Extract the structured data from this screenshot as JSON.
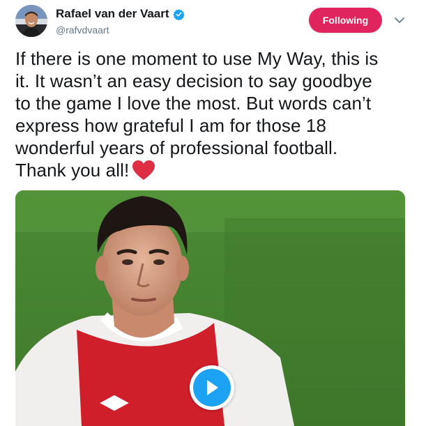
{
  "tweet": {
    "author": {
      "display_name": "Rafael van der Vaart",
      "handle": "@rafvdvaart",
      "verified": true,
      "avatar_icon": "profile-photo"
    },
    "follow_button": {
      "label": "Following",
      "color": "#e0245e"
    },
    "more_icon": "chevron-down-icon",
    "text_lines": [
      "If there is one moment to use My Way, this is",
      "it. It wasn’t an easy decision to say goodbye",
      "to the game I love the most. But words can’t",
      "express how grateful I am for those 18",
      "wonderful years of professional football.",
      "Thank you all!"
    ],
    "emoji": "red-heart-icon",
    "media": {
      "type": "video",
      "play_icon": "play-icon",
      "accent_color": "#1da1f2"
    }
  }
}
